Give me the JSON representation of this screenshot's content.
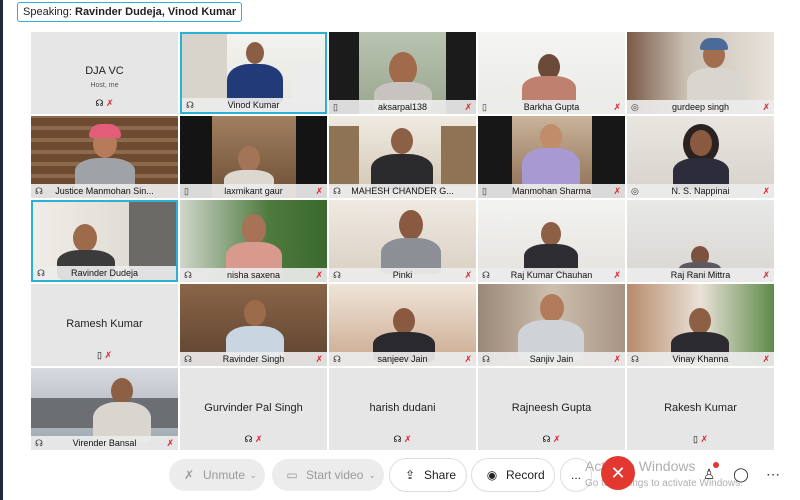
{
  "speaking": {
    "label": "Speaking:",
    "names": "Ravinder Dudeja, Vinod Kumar"
  },
  "tiles": {
    "t0": {
      "name": "DJA VC",
      "sub": "Host, me"
    },
    "t1": {
      "name": "Vinod Kumar"
    },
    "t2": {
      "name": "aksarpal138"
    },
    "t3": {
      "name": "Barkha Gupta"
    },
    "t4": {
      "name": "gurdeep singh"
    },
    "t5": {
      "name": "Justice Manmohan Sin..."
    },
    "t6": {
      "name": "laxmikant gaur"
    },
    "t7": {
      "name": "MAHESH CHANDER G..."
    },
    "t8": {
      "name": "Manmohan Sharma"
    },
    "t9": {
      "name": "N. S. Nappinai"
    },
    "t10": {
      "name": "Ravinder Dudeja"
    },
    "t11": {
      "name": "nisha saxena"
    },
    "t12": {
      "name": "Pinki"
    },
    "t13": {
      "name": "Raj Kumar Chauhan"
    },
    "t14": {
      "name": "Raj Rani Mittra"
    },
    "t15": {
      "name": "Ramesh Kumar"
    },
    "t16": {
      "name": "Ravinder Singh"
    },
    "t17": {
      "name": "sanjeev Jain"
    },
    "t18": {
      "name": "Sanjiv Jain"
    },
    "t19": {
      "name": "Vinay Khanna"
    },
    "t20": {
      "name": "Virender Bansal"
    },
    "t21": {
      "name": "Gurvinder Pal Singh"
    },
    "t22": {
      "name": "harish dudani"
    },
    "t23": {
      "name": "Rajneesh Gupta"
    },
    "t24": {
      "name": "Rakesh Kumar"
    }
  },
  "toolbar": {
    "unmute": "Unmute",
    "start_video": "Start video",
    "share": "Share",
    "record": "Record",
    "more": "...",
    "watermark_title": "Activate Windows",
    "watermark_sub": "Go to Settings to activate Windows."
  },
  "icons": {
    "mic_muted": "mic-muted-icon",
    "headset": "headset-icon",
    "phone": "phone-icon",
    "video_off": "video-off-icon",
    "share": "share-icon",
    "record": "record-icon",
    "end_call": "end-call-icon",
    "participants": "participants-icon",
    "chat": "chat-icon",
    "more": "more-icon"
  },
  "colors": {
    "highlight": "#2bb0d8",
    "muted": "#dd2233",
    "end_call": "#e2382f"
  }
}
